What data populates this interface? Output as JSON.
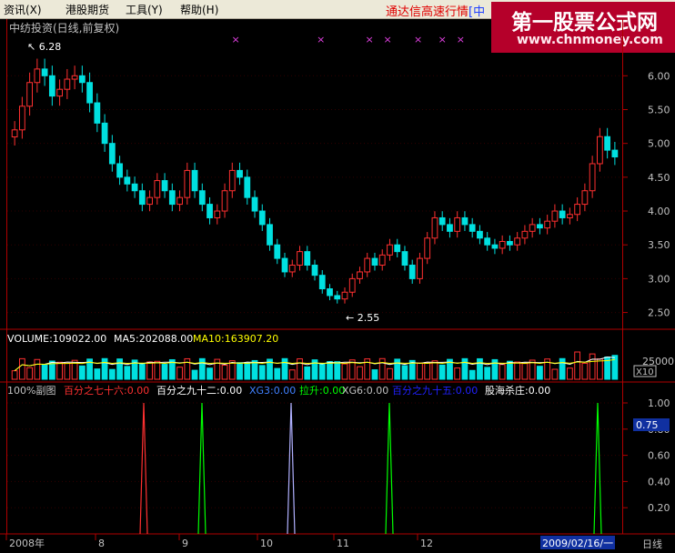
{
  "menu": {
    "items": [
      "资讯(X)",
      "港股期货",
      "工具(Y)",
      "帮助(H)"
    ],
    "marquee": "通达信高速行情",
    "marquee_tail": "[中"
  },
  "watermark": {
    "title": "第一股票公式网",
    "url": "www.chnmoney.com"
  },
  "colors": {
    "up": "#ff3030",
    "down": "#00e0e0",
    "axis": "#b00000",
    "text": "#c0c0c0",
    "ma5": "#ffffff",
    "ma10": "#ffff00"
  },
  "price_panel": {
    "stock_title": "中纺投资(日线,前复权)",
    "high_label": "6.28",
    "low_label": "2.55",
    "ticks": [
      "6.00",
      "5.50",
      "5.00",
      "4.50",
      "4.00",
      "3.50",
      "3.00",
      "2.50"
    ],
    "signal_marker": "×"
  },
  "volume_panel": {
    "volume_label": "VOLUME:109022.00",
    "ma5_label": "MA5:202088.00",
    "ma10_label": "MA10:163907.20",
    "tick_label": "25000",
    "unit_label": "X10"
  },
  "indicator_panel": {
    "labels": [
      {
        "text": "100%副图",
        "color": "#c0c0c0"
      },
      {
        "text": "百分之七十六:0.00",
        "color": "#ff3030"
      },
      {
        "text": "百分之九十二:0.00",
        "color": "#ffffff"
      },
      {
        "text": "XG3:0.00",
        "color": "#4080ff"
      },
      {
        "text": "拉升:0.00",
        "color": "#00ff00"
      },
      {
        "text": "XG6:0.00",
        "color": "#c0c0c0"
      },
      {
        "text": "百分之九十五:0.00",
        "color": "#2020ff"
      },
      {
        "text": "股海杀庄:0.00",
        "color": "#ffffff"
      }
    ],
    "ticks": [
      "1.00",
      "0.80",
      "0.60",
      "0.40",
      "0.20"
    ],
    "current_value": "0.75"
  },
  "time_axis": {
    "labels": [
      "2008年",
      "8",
      "9",
      "10",
      "11",
      "12",
      "2009/02/16/一"
    ],
    "period": "日线"
  },
  "chart_data": {
    "type": "candlestick",
    "title": "中纺投资(日线,前复权)",
    "price_range": [
      2.4,
      6.3
    ],
    "max_price": 6.28,
    "min_price": 2.55,
    "volume_tick": 25000,
    "spikes": [
      {
        "color": "#ff3030",
        "value": 1.0
      },
      {
        "color": "#00ff00",
        "value": 1.0
      },
      {
        "color": "#b0b0ff",
        "value": 1.0
      },
      {
        "color": "#00ff00",
        "value": 1.0
      },
      {
        "color": "#00ff00",
        "value": 1.0
      }
    ],
    "closes": [
      5.2,
      5.55,
      5.9,
      6.1,
      6.0,
      5.7,
      5.8,
      5.95,
      6.0,
      5.9,
      5.6,
      5.3,
      5.0,
      4.7,
      4.5,
      4.4,
      4.3,
      4.1,
      4.2,
      4.45,
      4.3,
      4.1,
      4.2,
      4.6,
      4.3,
      4.1,
      3.9,
      4.0,
      4.3,
      4.6,
      4.5,
      4.2,
      4.0,
      3.8,
      3.5,
      3.3,
      3.1,
      3.2,
      3.4,
      3.2,
      3.05,
      2.85,
      2.75,
      2.7,
      2.8,
      3.0,
      3.1,
      3.3,
      3.2,
      3.35,
      3.5,
      3.4,
      3.2,
      3.0,
      3.3,
      3.6,
      3.9,
      3.8,
      3.7,
      3.9,
      3.8,
      3.7,
      3.6,
      3.5,
      3.45,
      3.55,
      3.5,
      3.6,
      3.7,
      3.8,
      3.75,
      3.85,
      4.0,
      3.9,
      3.95,
      4.1,
      4.3,
      4.7,
      5.1,
      4.9,
      4.8
    ]
  }
}
